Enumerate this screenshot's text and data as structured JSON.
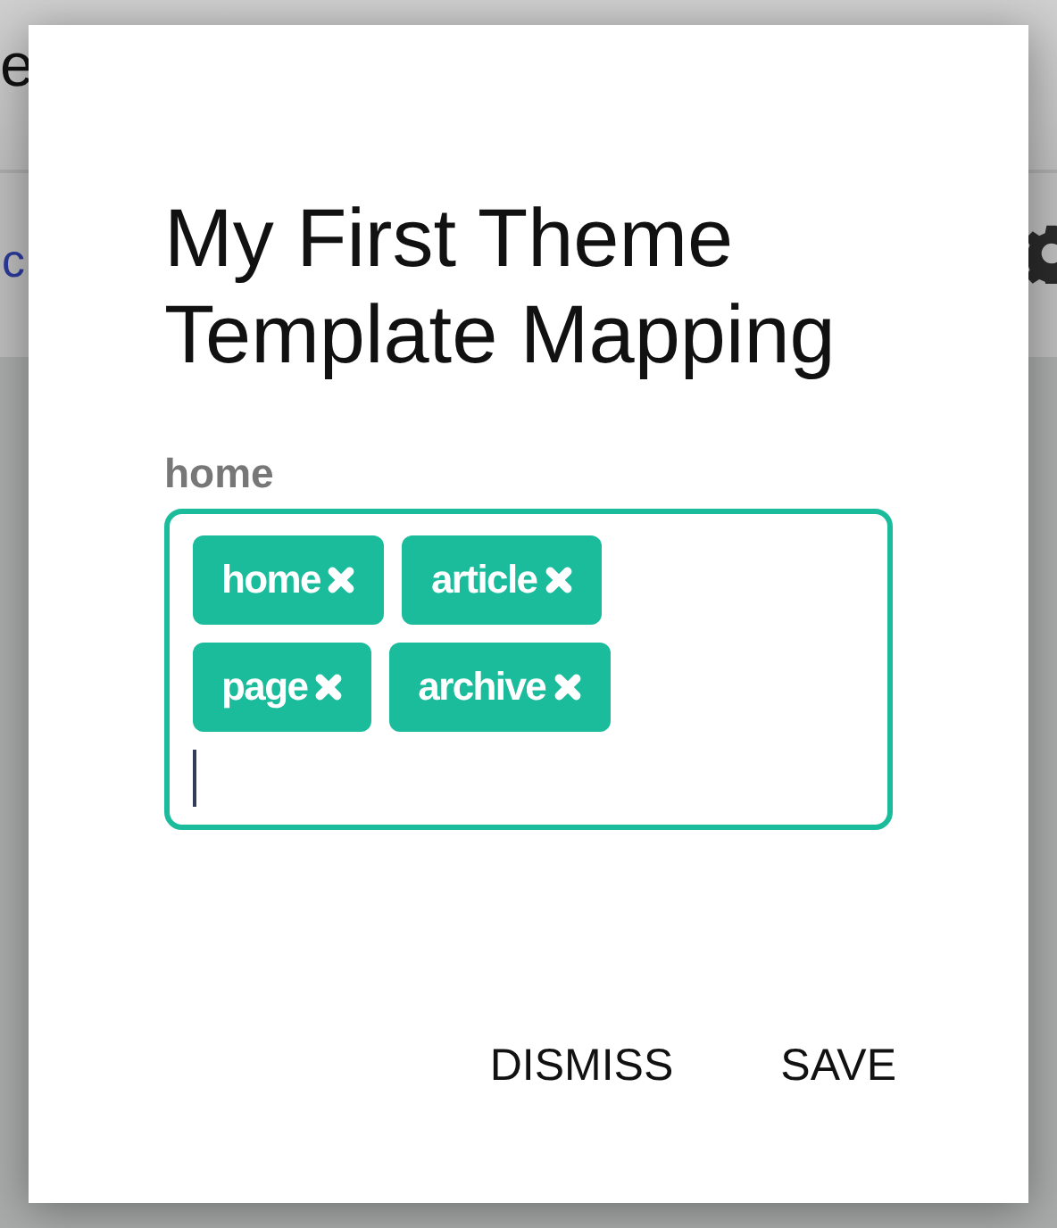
{
  "background": {
    "title": "e",
    "link": "c"
  },
  "dialog": {
    "title": "My First Theme Template Mapping",
    "field": {
      "label": "home",
      "tags": [
        {
          "label": "home"
        },
        {
          "label": "article"
        },
        {
          "label": "page"
        },
        {
          "label": "archive"
        }
      ]
    },
    "buttons": [
      "DISMISS",
      "SAVE"
    ]
  }
}
